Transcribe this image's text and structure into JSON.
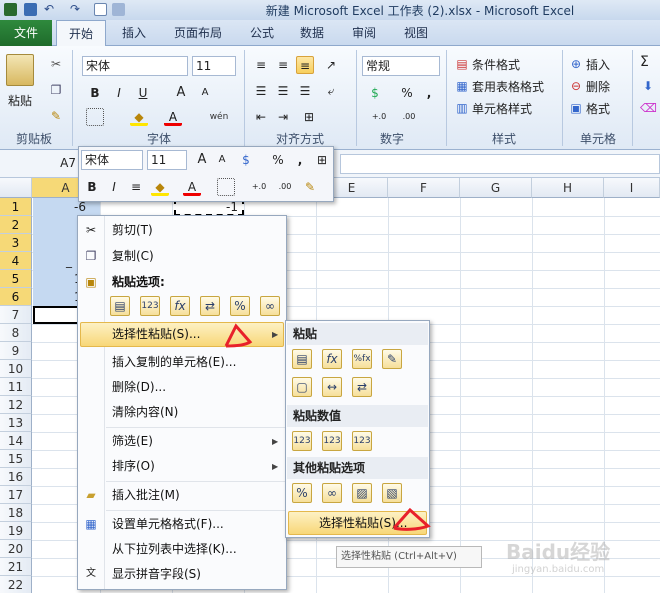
{
  "window": {
    "title": "新建 Microsoft Excel 工作表 (2).xlsx  -  Microsoft Excel"
  },
  "tabs": [
    "文件",
    "开始",
    "插入",
    "页面布局",
    "公式",
    "数据",
    "审阅",
    "视图"
  ],
  "ribbon": {
    "clipboard": {
      "label": "剪贴板",
      "paste": "粘贴"
    },
    "font": {
      "label": "字体",
      "name": "宋体",
      "size": "11",
      "bold": "B",
      "italic": "I",
      "underline": "U",
      "grow": "A",
      "shrink": "A",
      "color_a": "A",
      "phonetic": "wén"
    },
    "align": {
      "label": "对齐方式"
    },
    "number": {
      "label": "数字",
      "format": "常规",
      "percent": "%",
      "comma": ",",
      "inc": "+.0",
      "dec": ".00"
    },
    "styles": {
      "label": "样式",
      "cond": "条件格式",
      "table": "套用表格格式",
      "cell": "单元格样式"
    },
    "cells": {
      "label": "单元格",
      "insert": "插入",
      "delete": "删除",
      "format": "格式"
    },
    "editing": {
      "sigma": "Σ"
    }
  },
  "formula": {
    "namebox": "A7"
  },
  "minitoolbar": {
    "font": "宋体",
    "size": "11",
    "percent": "%",
    "bold": "B",
    "italic": "I",
    "color_a": "A",
    "inc": "+.0",
    "dec": ".00"
  },
  "sheet": {
    "columns": [
      "A",
      "B",
      "C",
      "D",
      "E",
      "F",
      "G",
      "H",
      "I"
    ],
    "rows": [
      "1",
      "2",
      "3",
      "4",
      "5",
      "6",
      "7",
      "8",
      "9",
      "10",
      "11",
      "12",
      "13",
      "14",
      "15",
      "16",
      "17",
      "18",
      "19",
      "20",
      "21",
      "22"
    ],
    "cells": {
      "a1": "-6",
      "c1": "-1",
      "a4": "_",
      "a5": "1",
      "a6": "1"
    }
  },
  "context_menu": {
    "cut": "剪切(T)",
    "copy": "复制(C)",
    "paste_options": "粘贴选项:",
    "paste_special": "选择性粘贴(S)...",
    "insert_copied": "插入复制的单元格(E)...",
    "delete": "删除(D)...",
    "clear": "清除内容(N)",
    "filter": "筛选(E)",
    "sort": "排序(O)",
    "comment": "插入批注(M)",
    "format_cells": "设置单元格格式(F)...",
    "pick_list": "从下拉列表中选择(K)...",
    "phonetic": "显示拼音字段(S)"
  },
  "submenu": {
    "paste": "粘贴",
    "values": "粘贴数值",
    "other": "其他粘贴选项",
    "special": "选择性粘贴(S)...",
    "tooltip": "选择性粘贴 (Ctrl+Alt+V)"
  },
  "watermark": {
    "brand": "Baidu经验",
    "url": "jingyan.baidu.com"
  },
  "icons": {
    "paste_123": "123",
    "paste_fx": "fx",
    "paste_pct": "%",
    "paste_pctfx": "%fx"
  },
  "colors": {
    "file_tab": "#217a33",
    "selection": "#f6d977",
    "annotation": "#e8202a"
  }
}
